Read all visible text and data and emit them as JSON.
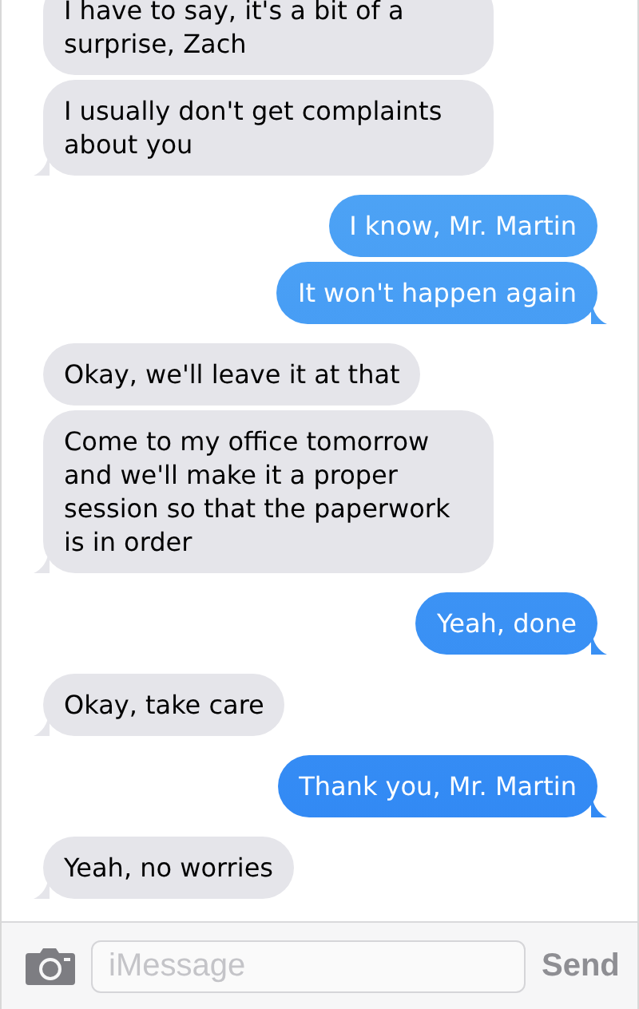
{
  "messages": [
    {
      "kind": "received",
      "text": "I have to say, it's a bit of a surprise, Zach",
      "tail": false
    },
    {
      "kind": "received",
      "text": "I usually don't get complaints about you",
      "tail": true
    },
    {
      "kind": "sent",
      "text": "I know, Mr. Martin",
      "tail": false
    },
    {
      "kind": "sent",
      "text": "It won't happen again",
      "tail": true
    },
    {
      "kind": "received",
      "text": "Okay, we'll leave it at that",
      "tail": false
    },
    {
      "kind": "received",
      "text": "Come to my office tomorrow and we'll make it a proper session so that the paperwork is in order",
      "tail": true
    },
    {
      "kind": "sent",
      "text": "Yeah, done",
      "tail": true
    },
    {
      "kind": "received",
      "text": "Okay, take care",
      "tail": true
    },
    {
      "kind": "sent",
      "text": "Thank you, Mr. Martin",
      "tail": true
    },
    {
      "kind": "received",
      "text": "Yeah, no worries",
      "tail": true
    }
  ],
  "composer": {
    "placeholder": "iMessage",
    "send": "Send"
  }
}
